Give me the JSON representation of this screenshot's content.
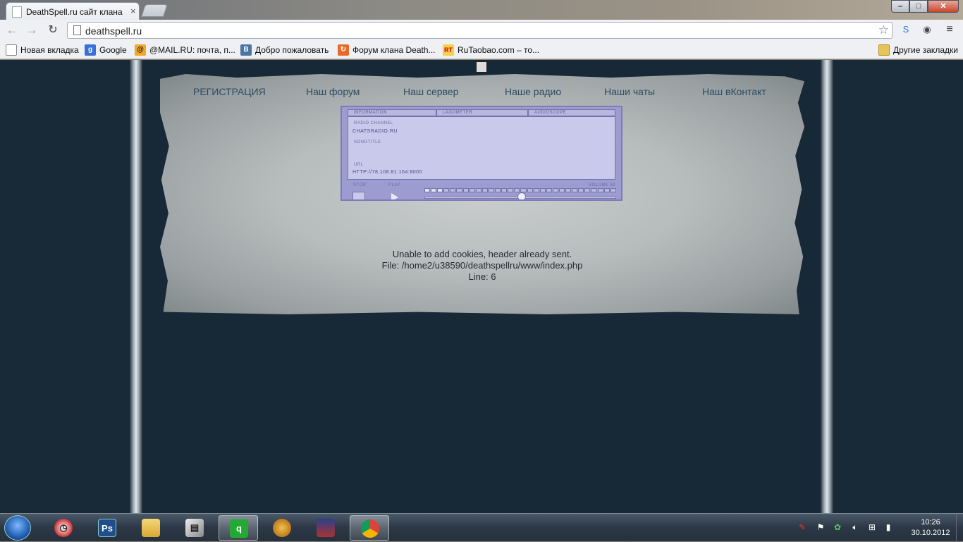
{
  "browser": {
    "tab_title": "DeathSpell.ru сайт клана D",
    "tab_close": "×",
    "url": "deathspell.ru",
    "window_buttons": {
      "minimize": "–",
      "maximize": "□",
      "close": "✕"
    }
  },
  "bookmarks": {
    "items": [
      {
        "label": "Новая вкладка",
        "icon": "page-icon"
      },
      {
        "label": "Google",
        "icon": "google-icon"
      },
      {
        "label": "@MAIL.RU: почта, п...",
        "icon": "mailru-icon"
      },
      {
        "label": "Добро пожаловать",
        "icon": "vk-icon"
      },
      {
        "label": "Форум клана Death...",
        "icon": "forum-icon"
      },
      {
        "label": "RuTaobao.com – то...",
        "icon": "rutaobao-icon"
      }
    ],
    "other": "Другие закладки"
  },
  "site": {
    "nav": [
      "РЕГИСТРАЦИЯ",
      "Наш форум",
      "Наш сервер",
      "Наше радио",
      "Наши чаты",
      "Наш вКонтакт"
    ],
    "player": {
      "tabs": [
        "INFORMATION",
        "LAGOMETER",
        "AUDIOSCOPE"
      ],
      "radio_channel_label": "RADIO CHANNEL",
      "radio_channel_value": "CHATSRADIO.RU",
      "songtitle_label": "SONGTITLE",
      "url_label": "URL",
      "url_value": "HTTP://78.108.81.164:8000",
      "stop_label": "STOP",
      "play_label": "PLAY",
      "volume_label": "VOLUME 50",
      "volume_level": 0.5
    },
    "error_lines": [
      "Unable to add cookies, header already sent.",
      "File: /home2/u38590/deathspellru/www/index.php",
      "Line: 6"
    ]
  },
  "taskbar": {
    "apps": [
      {
        "name": "clock-app-icon",
        "label": ""
      },
      {
        "name": "photoshop-icon",
        "label": "Ps"
      },
      {
        "name": "explorer-icon",
        "label": ""
      },
      {
        "name": "scanner-icon",
        "label": ""
      },
      {
        "name": "qip-icon",
        "label": ""
      },
      {
        "name": "game-icon",
        "label": ""
      },
      {
        "name": "wizard-game-icon",
        "label": ""
      },
      {
        "name": "chrome-icon",
        "label": ""
      }
    ],
    "time": "10:26",
    "date": "30.10.2012"
  },
  "colors": {
    "page_background": "#182a38",
    "link": "#2c4a63",
    "player": "#9c9cd0"
  }
}
